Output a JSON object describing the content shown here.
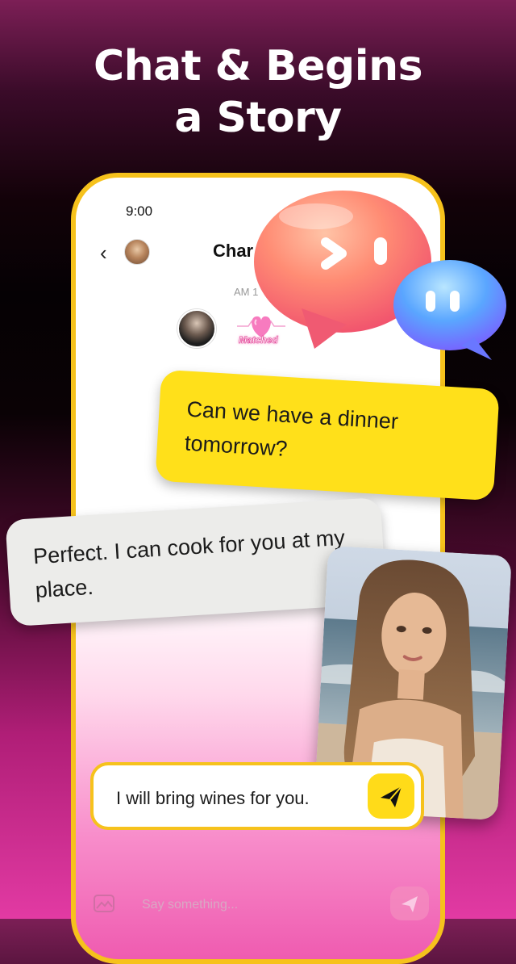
{
  "headline": {
    "line1": "Chat & Begins",
    "line2": "a Story"
  },
  "phone": {
    "status_time": "9:00",
    "back_glyph": "‹",
    "chat_title": "Char",
    "time_label": "AM 1",
    "match_label": "Matched",
    "input_placeholder": "Say something..."
  },
  "messages": {
    "outgoing": "Can we have a dinner tomorrow?",
    "incoming": "Perfect. I can cook for you at my place.",
    "draft": "I will bring wines for you."
  },
  "icons": {
    "back": "back-icon",
    "image": "image-icon",
    "send": "send-icon",
    "heart": "heart-icon",
    "bubble_orange": "chat-bubble-icon",
    "bubble_blue": "chat-bubble-icon"
  },
  "colors": {
    "accent_yellow": "#ffdb19",
    "frame_yellow": "#f6c21c",
    "pink": "#ef5bb0",
    "bubble_gray": "#ececea"
  }
}
